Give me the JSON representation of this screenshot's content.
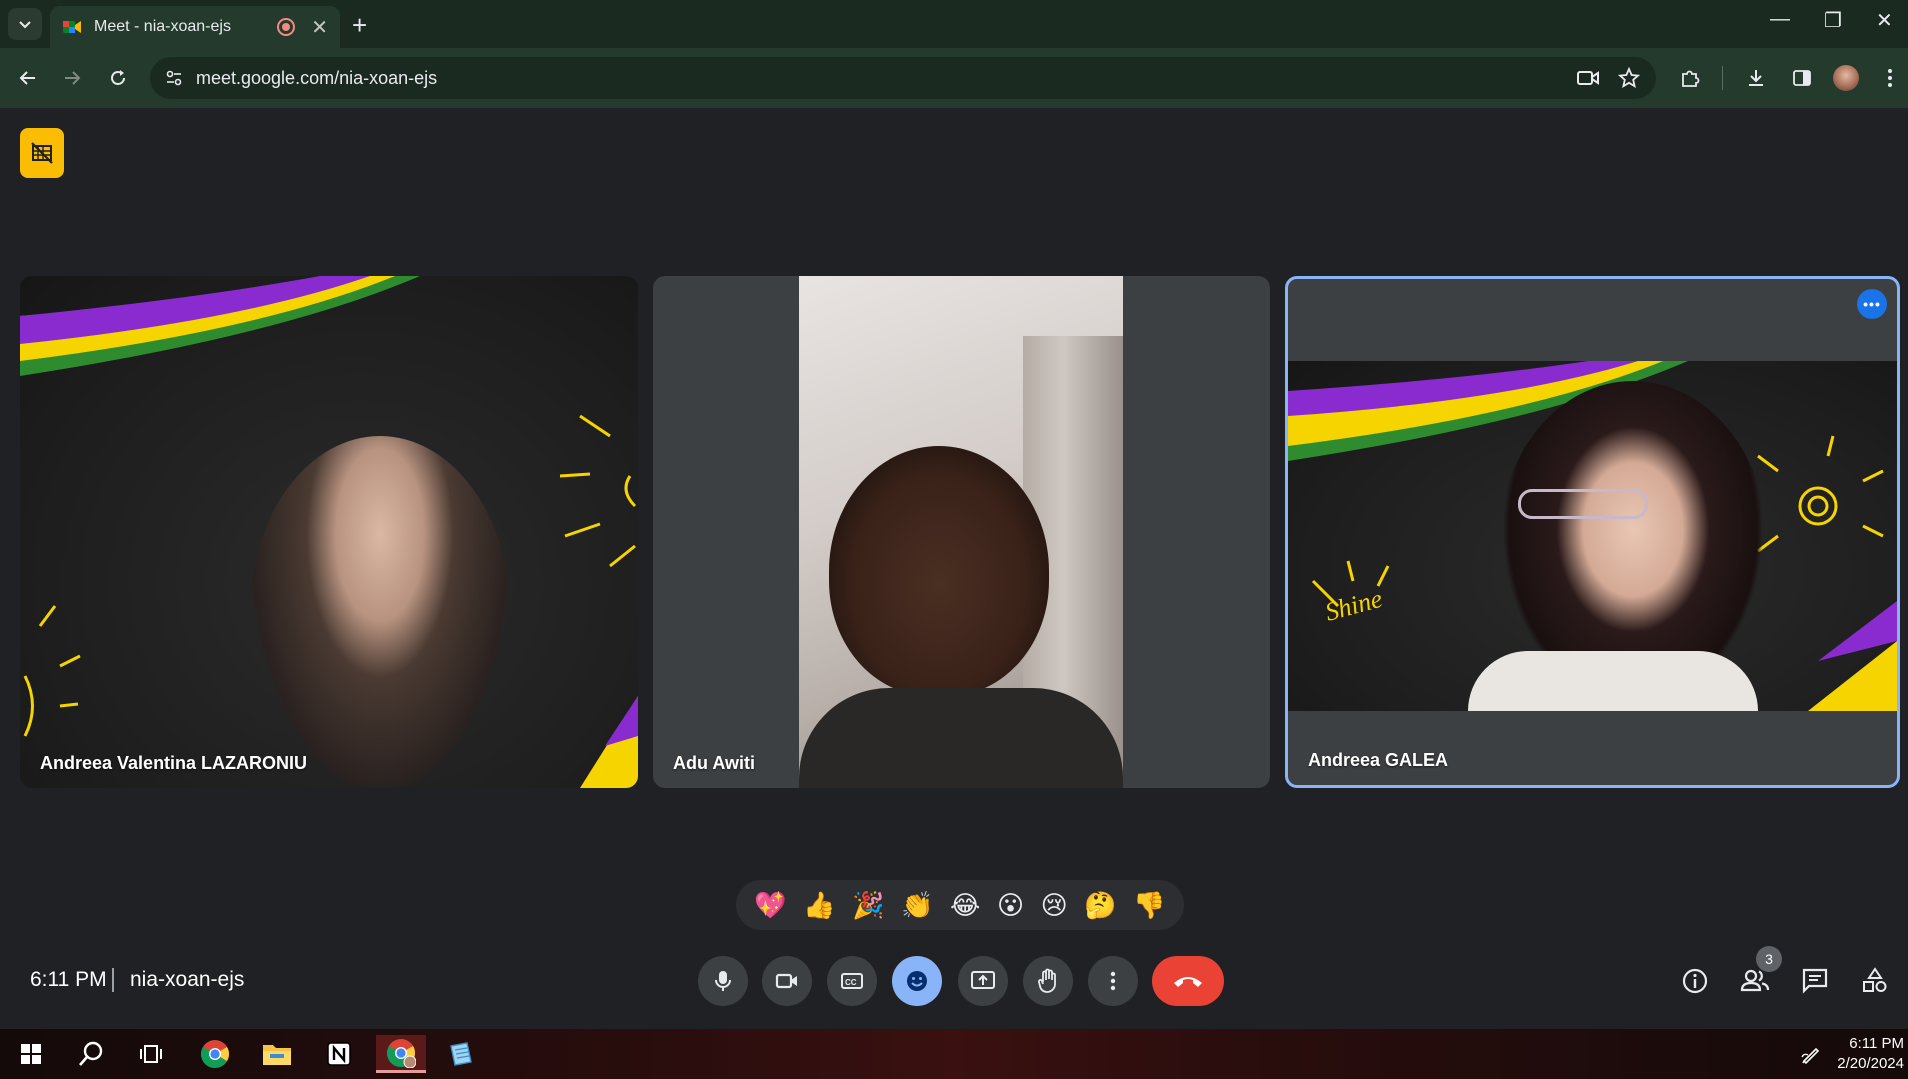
{
  "browser": {
    "tab_title": "Meet - nia-xoan-ejs",
    "url": "meet.google.com/nia-xoan-ejs"
  },
  "meeting": {
    "time": "6:11 PM",
    "code": "nia-xoan-ejs",
    "participant_count": "3"
  },
  "participants": [
    {
      "name": "Andreea Valentina LAZARONIU"
    },
    {
      "name": "Adu Awiti"
    },
    {
      "name": "Andreea GALEA"
    }
  ],
  "reactions": [
    "💖",
    "👍",
    "🎉",
    "👏",
    "😂",
    "😮",
    "😢",
    "🤔",
    "👎"
  ],
  "taskbar": {
    "clock_time": "6:11 PM",
    "clock_date": "2/20/2024"
  },
  "colors": {
    "accent_blue": "#8ab4f8",
    "hangup_red": "#ea4335",
    "badge_yellow": "#fbbc04"
  }
}
